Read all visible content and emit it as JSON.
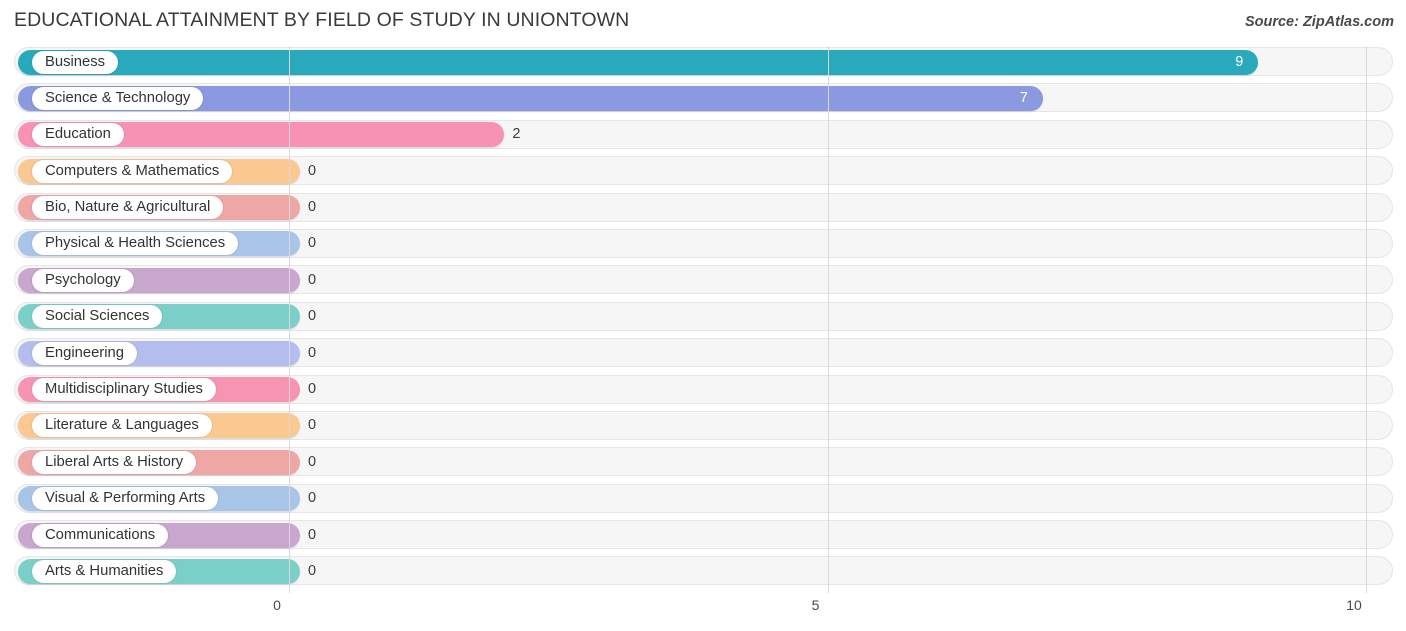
{
  "header": {
    "title": "EDUCATIONAL ATTAINMENT BY FIELD OF STUDY IN UNIONTOWN",
    "source": "Source: ZipAtlas.com"
  },
  "chart_data": {
    "type": "bar",
    "orientation": "horizontal",
    "title": "EDUCATIONAL ATTAINMENT BY FIELD OF STUDY IN UNIONTOWN",
    "xlabel": "",
    "ylabel": "",
    "xlim": [
      0,
      10
    ],
    "xticks": [
      0,
      5,
      10
    ],
    "xticklabels": [
      "0",
      "5",
      "10"
    ],
    "grid": true,
    "legend": false,
    "categories": [
      "Business",
      "Science & Technology",
      "Education",
      "Computers & Mathematics",
      "Bio, Nature & Agricultural",
      "Physical & Health Sciences",
      "Psychology",
      "Social Sciences",
      "Engineering",
      "Multidisciplinary Studies",
      "Literature & Languages",
      "Liberal Arts & History",
      "Visual & Performing Arts",
      "Communications",
      "Arts & Humanities"
    ],
    "values": [
      9,
      7,
      2,
      0,
      0,
      0,
      0,
      0,
      0,
      0,
      0,
      0,
      0,
      0,
      0
    ],
    "value_labels": [
      "9",
      "7",
      "2",
      "0",
      "0",
      "0",
      "0",
      "0",
      "0",
      "0",
      "0",
      "0",
      "0",
      "0",
      "0"
    ],
    "colors": [
      "#29a9bc",
      "#8b9ae0",
      "#f792b4",
      "#fbc891",
      "#efa7a6",
      "#a8c5e8",
      "#c8a6cd",
      "#7bcfc9",
      "#b4bdee",
      "#f794b1",
      "#fbc891",
      "#efa7a6",
      "#a8c5e8",
      "#c8a6cd",
      "#7bcfc9"
    ]
  }
}
